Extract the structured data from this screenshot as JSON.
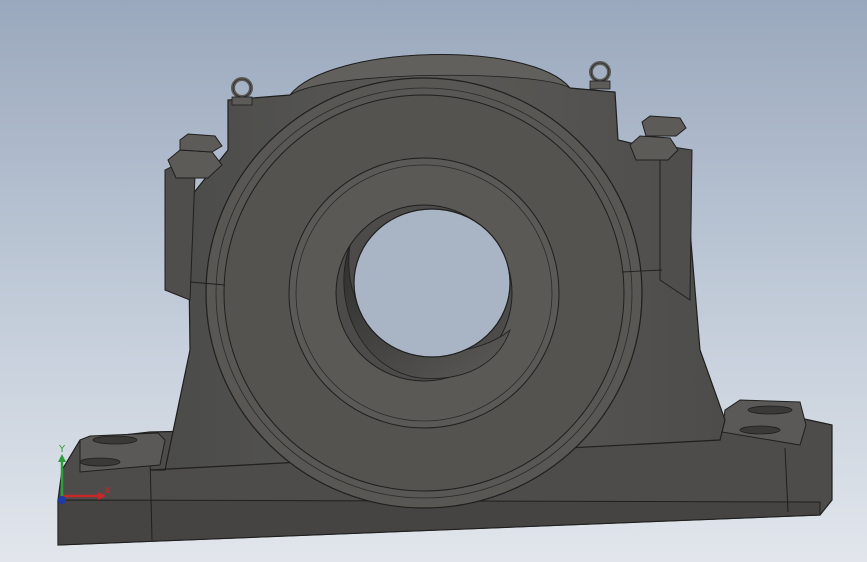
{
  "triad": {
    "x_label": "X",
    "y_label": "Y",
    "colors": {
      "x": "#c62828",
      "y": "#2e9e3c",
      "z": "#1e3aa8"
    }
  },
  "model": {
    "part": "pillow-block-bearing-housing",
    "colors": {
      "body": "#565552",
      "body_dark": "#3f3f3d",
      "edge": "#1f1f1e",
      "bore_inner": "#3a3938",
      "background_top": "#9aa8bd",
      "background_bottom": "#e2e6ec"
    }
  }
}
